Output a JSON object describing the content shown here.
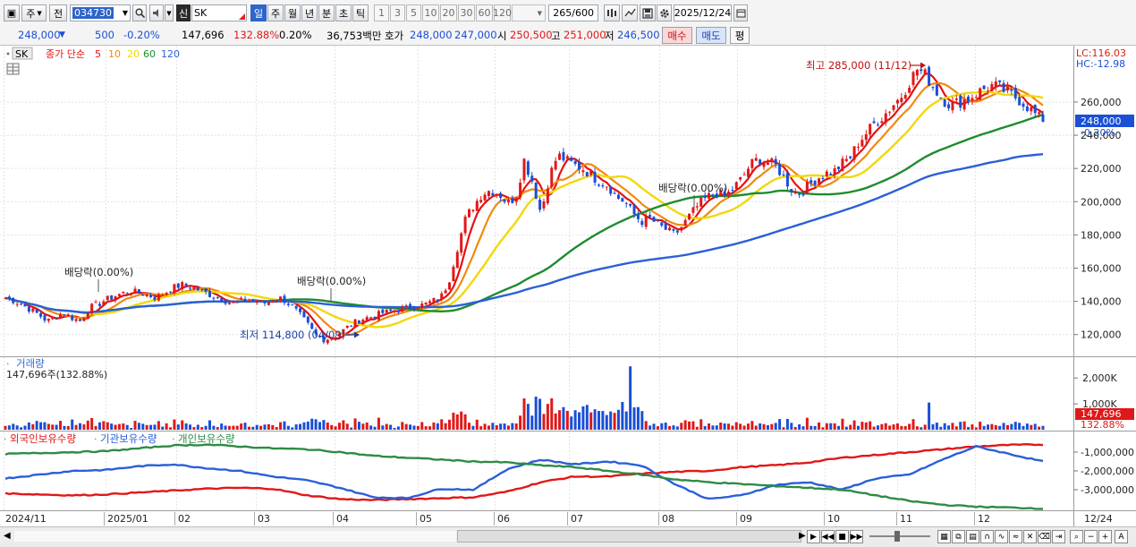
{
  "toolbar": {
    "market": "주",
    "prev_label": "전",
    "code": "034730",
    "chart_type": "신",
    "name": "SK",
    "periods": [
      "일",
      "주",
      "월",
      "년",
      "분",
      "초",
      "틱"
    ],
    "minutes": [
      "1",
      "3",
      "5",
      "10",
      "20",
      "30",
      "60",
      "120"
    ],
    "count": "265",
    "count_total": "/600",
    "date": "2025/12/24"
  },
  "quote": {
    "price": "248,000",
    "change": "500",
    "change_pct": "-0.20%",
    "volume": "147,696",
    "volume_ratio": "132.88%",
    "turnover_ratio": "0.20%",
    "amount": "36,753백만",
    "ask_label": "호가",
    "ask": "248,000",
    "bid": "247,000",
    "open_label": "시",
    "open": "250,500",
    "high_label": "고",
    "high": "251,000",
    "low_label": "저",
    "low": "246,500",
    "buy_button": "매수",
    "sell_button": "매도",
    "avg_button": "평"
  },
  "legend": {
    "name": "SK",
    "title": "종가 단순",
    "ma": [
      {
        "label": "5",
        "color": "#e81010"
      },
      {
        "label": "10",
        "color": "#f08a10"
      },
      {
        "label": "20",
        "color": "#f2d80a"
      },
      {
        "label": "60",
        "color": "#1e8c2e"
      },
      {
        "label": "120",
        "color": "#2b5fd8"
      }
    ]
  },
  "annotations": {
    "high": "최고 285,000 (11/12)",
    "low": "최저 114,800 (04/09)",
    "dividend": "배당락(0.00%)",
    "lc": "LC:116.03",
    "hc": "HC:-12.98",
    "last_price": "248,000",
    "last_pct": "-0.20%"
  },
  "volume": {
    "title": "거래량",
    "info": "147,696주(132.88%)",
    "last": "147,696",
    "last_pct": "132.88%"
  },
  "holdings": {
    "series": [
      {
        "name": "외국인보유수량",
        "color": "#e01818"
      },
      {
        "name": "기관보유수량",
        "color": "#2b5fd8"
      },
      {
        "name": "개인보유수량",
        "color": "#2e8b47"
      }
    ]
  },
  "chart_data": [
    {
      "type": "candlestick",
      "title": "SK",
      "y_ticks": [
        "260,000",
        "240,000",
        "220,000",
        "200,000",
        "180,000",
        "160,000",
        "140,000",
        "120,000"
      ],
      "ylim": [
        108000,
        288000
      ],
      "x_labels": [
        "2024/11",
        "2025/01",
        "02",
        "03",
        "04",
        "05",
        "06",
        "07",
        "08",
        "09",
        "10",
        "11",
        "12",
        "12/24"
      ],
      "moving_averages": [
        "5",
        "10",
        "20",
        "60",
        "120"
      ],
      "high": {
        "value": 285000,
        "date": "11/12"
      },
      "low": {
        "value": 114800,
        "date": "04/09"
      },
      "last": 248000,
      "close_path": [
        142000,
        140500,
        138000,
        135000,
        132000,
        128000,
        131000,
        133000,
        130000,
        128000,
        136000,
        138000,
        141000,
        143000,
        145000,
        146000,
        145000,
        144000,
        142000,
        145000,
        148000,
        150000,
        149000,
        147000,
        145000,
        143000,
        141000,
        139000,
        140000,
        141000,
        140000,
        139000,
        141000,
        142000,
        138000,
        133000,
        127000,
        120000,
        117000,
        118000,
        121000,
        125000,
        128000,
        130000,
        131000,
        133000,
        134000,
        135000,
        136000,
        137000,
        138000,
        140000,
        142000,
        152000,
        172000,
        190000,
        198000,
        205000,
        207000,
        205000,
        199000,
        203000,
        225000,
        212000,
        193000,
        215000,
        228000,
        225000,
        222000,
        220000,
        216000,
        212000,
        210000,
        203000,
        200000,
        193000,
        188000,
        190000,
        186000,
        183000,
        180000,
        186000,
        193000,
        199000,
        203000,
        205000,
        203000,
        208000,
        214000,
        222000,
        226000,
        224000,
        222000,
        215000,
        207000,
        205000,
        210000,
        214000,
        217000,
        218000,
        223000,
        227000,
        236000,
        242000,
        248000,
        252000,
        258000,
        263000,
        272000,
        280000,
        276000,
        268000,
        262000,
        258000,
        260000,
        262000,
        265000,
        268000,
        270000,
        268000,
        265000,
        262000,
        258000,
        253000,
        248000
      ]
    },
    {
      "type": "bar",
      "title": "거래량",
      "y_ticks": [
        "2,000K",
        "1,000K"
      ],
      "ylim": [
        0,
        2700
      ],
      "last": 147696
    },
    {
      "type": "line",
      "y_ticks": [
        "-1,000,000",
        "-2,000,000",
        "-3,000,000"
      ],
      "ylim": [
        -4000000,
        0
      ],
      "series": [
        {
          "name": "외국인보유수량",
          "values": [
            -3200000,
            -3250000,
            -3300000,
            -3250000,
            -3150000,
            -3050000,
            -2950000,
            -2900000,
            -2950000,
            -3300000,
            -3500000,
            -3550000,
            -3500000,
            -3450000,
            -3400000,
            -3100000,
            -2600000,
            -2300000,
            -2300000,
            -2150000,
            -2050000,
            -2000000,
            -1800000,
            -1700000,
            -1550000,
            -1300000,
            -1150000,
            -1000000,
            -850000,
            -700000,
            -620000,
            -600000
          ]
        },
        {
          "name": "기관보유수량",
          "values": [
            -2400000,
            -2200000,
            -2000000,
            -1950000,
            -1750000,
            -1650000,
            -1850000,
            -2000000,
            -2300000,
            -2500000,
            -2900000,
            -3400000,
            -3450000,
            -2950000,
            -3000000,
            -1900000,
            -1400000,
            -1650000,
            -1500000,
            -1700000,
            -2700000,
            -3500000,
            -3300000,
            -2750000,
            -2600000,
            -3000000,
            -2400000,
            -2200000,
            -1400000,
            -700000,
            -1100000,
            -1500000
          ]
        },
        {
          "name": "개인보유수량",
          "values": [
            -1100000,
            -1050000,
            -1000000,
            -950000,
            -800000,
            -650000,
            -600000,
            -700000,
            -800000,
            -850000,
            -1000000,
            -1200000,
            -1300000,
            -1400000,
            -1500000,
            -1550000,
            -1700000,
            -1800000,
            -2000000,
            -2200000,
            -2450000,
            -2600000,
            -2700000,
            -2800000,
            -2900000,
            -3000000,
            -3300000,
            -3600000,
            -3800000,
            -3900000,
            -3950000,
            -4000000
          ]
        }
      ]
    }
  ]
}
